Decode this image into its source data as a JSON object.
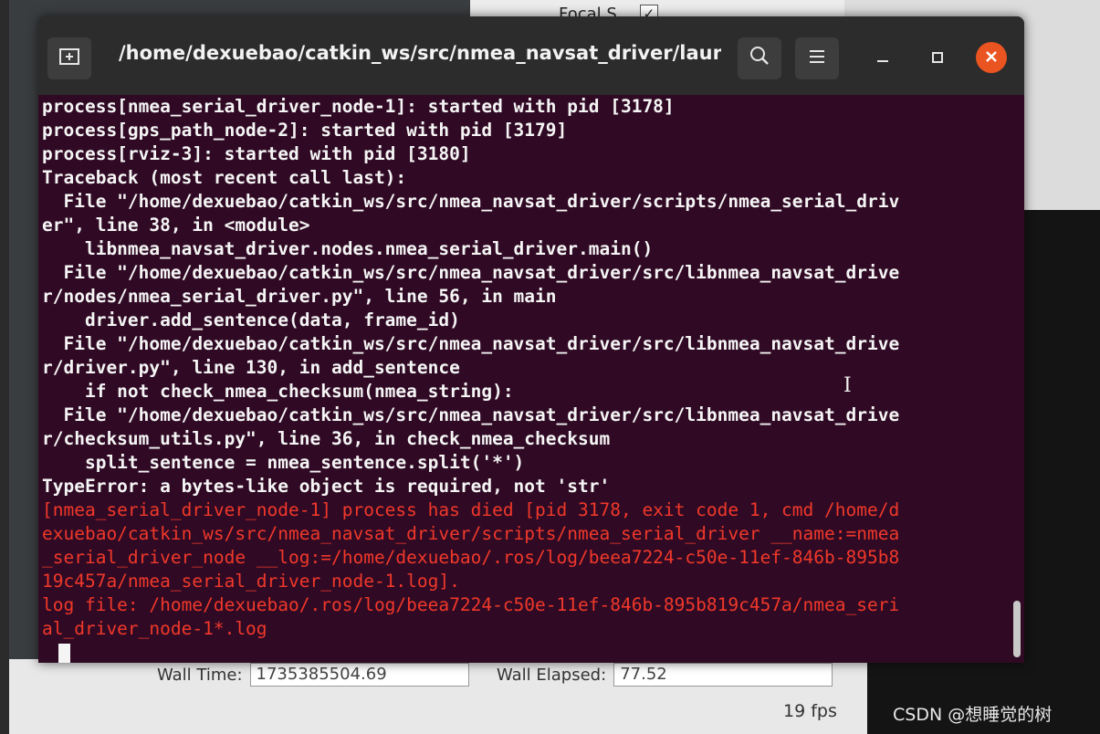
{
  "background": {
    "focal_label": "Focal S...",
    "focal_checked": "✓",
    "wall_time_label": "Wall Time:",
    "wall_time_value": "1735385504.69",
    "wall_elapsed_label": "Wall Elapsed:",
    "wall_elapsed_value": "77.52",
    "fps": "19 fps",
    "watermark": "CSDN @想睡觉的树"
  },
  "terminal": {
    "title": "/home/dexuebao/catkin_ws/src/nmea_navsat_driver/launch/...",
    "icons": {
      "new_tab": "new-tab-icon",
      "search": "search-icon",
      "menu": "hamburger-menu-icon",
      "minimize": "minimize-icon",
      "maximize": "maximize-icon",
      "close": "close-icon"
    },
    "lines": [
      {
        "text": "process[nmea_serial_driver_node-1]: started with pid [3178]",
        "type": "normal"
      },
      {
        "text": "process[gps_path_node-2]: started with pid [3179]",
        "type": "normal"
      },
      {
        "text": "process[rviz-3]: started with pid [3180]",
        "type": "normal"
      },
      {
        "text": "Traceback (most recent call last):",
        "type": "normal"
      },
      {
        "text": "  File \"/home/dexuebao/catkin_ws/src/nmea_navsat_driver/scripts/nmea_serial_driv",
        "type": "normal"
      },
      {
        "text": "er\", line 38, in <module>",
        "type": "normal"
      },
      {
        "text": "    libnmea_navsat_driver.nodes.nmea_serial_driver.main()",
        "type": "normal"
      },
      {
        "text": "  File \"/home/dexuebao/catkin_ws/src/nmea_navsat_driver/src/libnmea_navsat_drive",
        "type": "normal"
      },
      {
        "text": "r/nodes/nmea_serial_driver.py\", line 56, in main",
        "type": "normal"
      },
      {
        "text": "    driver.add_sentence(data, frame_id)",
        "type": "normal"
      },
      {
        "text": "  File \"/home/dexuebao/catkin_ws/src/nmea_navsat_driver/src/libnmea_navsat_drive",
        "type": "normal"
      },
      {
        "text": "r/driver.py\", line 130, in add_sentence",
        "type": "normal"
      },
      {
        "text": "    if not check_nmea_checksum(nmea_string):",
        "type": "normal"
      },
      {
        "text": "  File \"/home/dexuebao/catkin_ws/src/nmea_navsat_driver/src/libnmea_navsat_drive",
        "type": "normal"
      },
      {
        "text": "r/checksum_utils.py\", line 36, in check_nmea_checksum",
        "type": "normal"
      },
      {
        "text": "    split_sentence = nmea_sentence.split('*')",
        "type": "normal"
      },
      {
        "text": "TypeError: a bytes-like object is required, not 'str'",
        "type": "normal"
      },
      {
        "text": "[nmea_serial_driver_node-1] process has died [pid 3178, exit code 1, cmd /home/d",
        "type": "err"
      },
      {
        "text": "exuebao/catkin_ws/src/nmea_navsat_driver/scripts/nmea_serial_driver __name:=nmea",
        "type": "err"
      },
      {
        "text": "_serial_driver_node __log:=/home/dexuebao/.ros/log/beea7224-c50e-11ef-846b-895b8",
        "type": "err"
      },
      {
        "text": "19c457a/nmea_serial_driver_node-1.log].",
        "type": "err"
      },
      {
        "text": "log file: /home/dexuebao/.ros/log/beea7224-c50e-11ef-846b-895b819c457a/nmea_seri",
        "type": "err"
      },
      {
        "text": "al_driver_node-1*.log",
        "type": "err"
      }
    ]
  },
  "colors": {
    "terminal_bg": "#300a24",
    "error_text": "#f0382a",
    "close_button": "#e95420"
  }
}
